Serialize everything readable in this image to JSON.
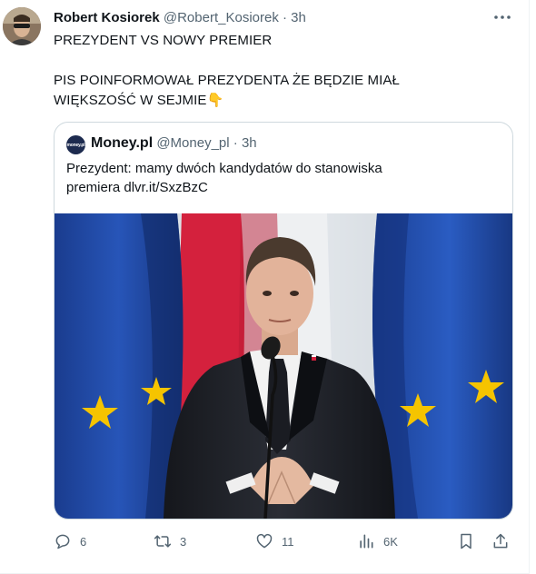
{
  "tweet": {
    "author_name": "Robert Kosiorek",
    "author_handle": "@Robert_Kosiorek",
    "separator": "·",
    "time": "3h",
    "line1": "PREZYDENT VS NOWY PREMIER",
    "line2": "PIS POINFORMOWAŁ PREZYDENTA ŻE BĘDZIE MIAŁ",
    "line3": "WIĘKSZOŚĆ W SEJMIE👇",
    "avatar_icon": "user-avatar",
    "more_icon": "more-horizontal-icon"
  },
  "quote": {
    "avatar_text": "money.pl",
    "author_name": "Money.pl",
    "author_handle": "@Money_pl",
    "separator": "·",
    "time": "3h",
    "text_line1": "Prezydent: mamy dwóch kandydatów do stanowiska",
    "text_line2_prefix": "premiera ",
    "text_link": "dlvr.it/SxzBzC",
    "image_icon": "press-conference-photo"
  },
  "actions": {
    "reply_count": "6",
    "retweet_count": "3",
    "like_count": "11",
    "views_count": "6K"
  },
  "colors": {
    "text": "#0f1419",
    "secondary": "#536471",
    "border": "#cfd9de",
    "eu_blue": "#1f47a3",
    "eu_star": "#f5c400",
    "pl_red": "#d4213d"
  }
}
